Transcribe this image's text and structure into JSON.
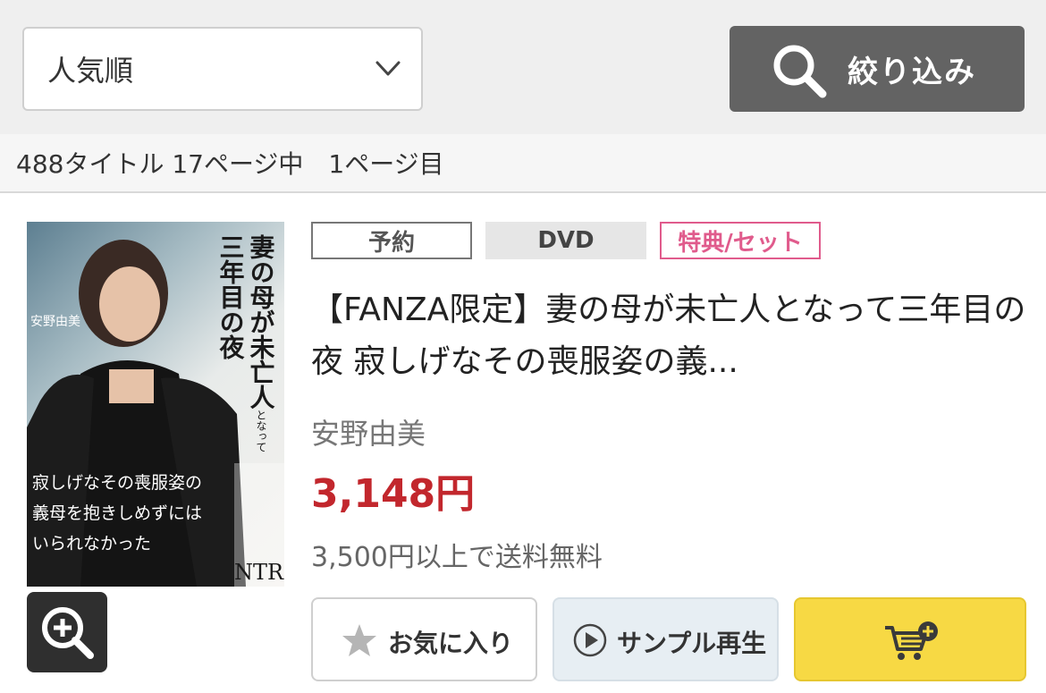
{
  "sort": {
    "selected": "人気順"
  },
  "filter": {
    "label": "絞り込み"
  },
  "results": {
    "summary": "488タイトル 17ページ中　1ページ目"
  },
  "product": {
    "badges": {
      "reserve": "予約",
      "format": "DVD",
      "bonus": "特典/セット"
    },
    "title": "【FANZA限定】妻の母が未亡人となって三年目の夜 寂しげなその喪服姿の義...",
    "actress": "安野由美",
    "price": "3,148円",
    "shipping": "3,500円以上で送料無料",
    "cover_text": {
      "title_line1": "妻の母が未亡人",
      "title_line2": "となって",
      "title_line3": "三年目の夜",
      "name": "安野由美",
      "tagline1": "寂しげなその喪服姿の",
      "tagline2": "義母を抱きしめずには",
      "tagline3": "いられなかった",
      "brand": "NTR"
    },
    "buttons": {
      "favorite": "お気に入り",
      "sample": "サンプル再生"
    }
  },
  "colors": {
    "price": "#c2272d",
    "bonus_badge": "#e05b8c",
    "cart_button": "#f7d944",
    "filter_button": "#636363"
  },
  "icons": [
    "chevron-down-icon",
    "search-icon",
    "zoom-in-icon",
    "star-icon",
    "play-icon",
    "cart-add-icon"
  ]
}
